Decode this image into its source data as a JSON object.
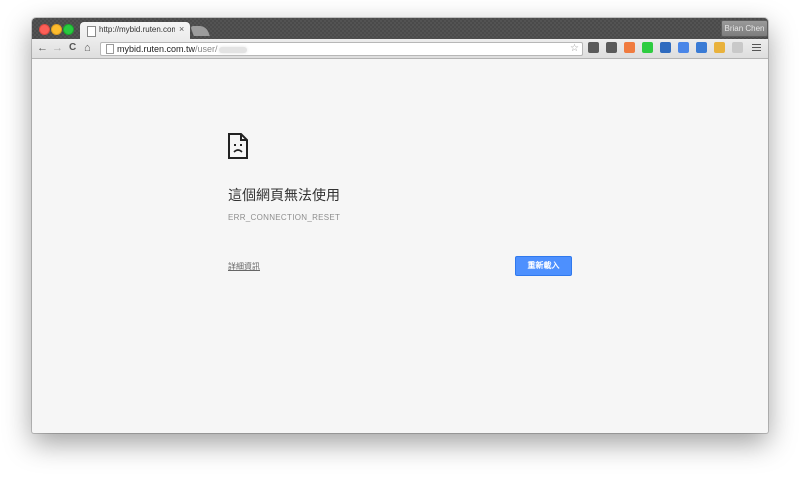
{
  "browser": {
    "tab": {
      "title": "http://mybid.ruten.com.tw/user/",
      "close": "×"
    },
    "profile_name": "Brian Chen",
    "nav": {
      "back": "←",
      "forward": "→",
      "reload": "C",
      "home": "⌂"
    },
    "omnibox": {
      "host": "mybid.ruten.com.tw",
      "path": "/user/",
      "star": "☆"
    },
    "extensions": [
      {
        "name": "evernote-icon",
        "color": "#5a5a5a"
      },
      {
        "name": "pocket-icon",
        "color": "#5a5a5a"
      },
      {
        "name": "rss-icon",
        "color": "#f07b3f"
      },
      {
        "name": "green-circle-icon",
        "color": "#2ecc40"
      },
      {
        "name": "vimium-icon",
        "color": "#2f6bbf"
      },
      {
        "name": "translate-icon",
        "color": "#4a86e8"
      },
      {
        "name": "s-blue-icon",
        "color": "#3a7bd5"
      },
      {
        "name": "colorful-icon",
        "color": "#e9b23c"
      },
      {
        "name": "feather-icon",
        "color": "#c9c9c9"
      }
    ]
  },
  "error_page": {
    "icon": "sad-page-icon",
    "title": "這個網頁無法使用",
    "error_code": "ERR_CONNECTION_RESET",
    "details_link": "詳細資訊",
    "reload_button": "重新載入"
  },
  "colors": {
    "reload_button": "#4d90fe",
    "page_background": "#f6f6f6"
  }
}
